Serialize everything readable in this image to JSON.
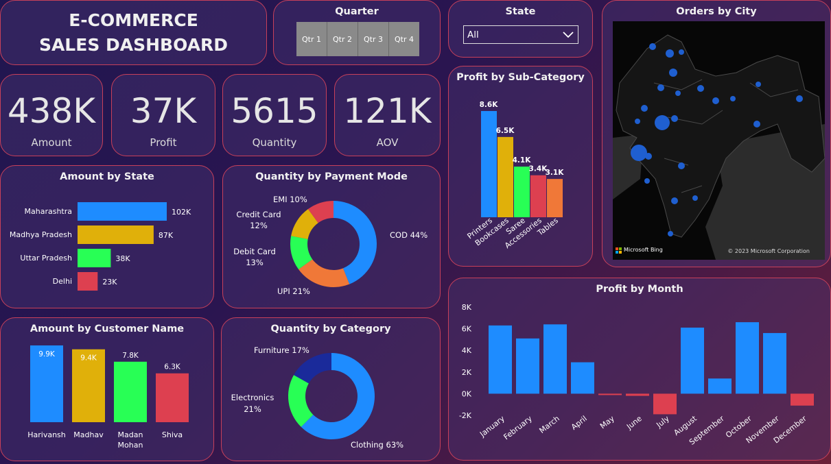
{
  "title": {
    "line1": "E-COMMERCE",
    "line2": "SALES DASHBOARD"
  },
  "quarter": {
    "title": "Quarter",
    "options": [
      "Qtr 1",
      "Qtr 2",
      "Qtr 3",
      "Qtr 4"
    ]
  },
  "state_filter": {
    "title": "State",
    "value": "All"
  },
  "kpis": [
    {
      "value": "438K",
      "label": "Amount"
    },
    {
      "value": "37K",
      "label": "Profit"
    },
    {
      "value": "5615",
      "label": "Quantity"
    },
    {
      "value": "121K",
      "label": "AOV"
    }
  ],
  "map": {
    "title": "Orders by City",
    "bing": "Microsoft Bing",
    "copyright": "© 2023 Microsoft Corporation"
  },
  "colors": {
    "blue": "#1e8cff",
    "gold": "#e0b00a",
    "green": "#28ff55",
    "red": "#dd4050",
    "orange": "#f07838",
    "navy": "#1a2a9a",
    "border": "#c8405a"
  },
  "chart_data": [
    {
      "id": "amount_by_state",
      "type": "bar",
      "orientation": "horizontal",
      "title": "Amount by State",
      "categories": [
        "Maharashtra",
        "Madhya Pradesh",
        "Uttar Pradesh",
        "Delhi"
      ],
      "values": [
        102,
        87,
        38,
        23
      ],
      "value_labels": [
        "102K",
        "87K",
        "38K",
        "23K"
      ],
      "colors": [
        "#1e8cff",
        "#e0b00a",
        "#28ff55",
        "#dd4050"
      ]
    },
    {
      "id": "quantity_by_payment_mode",
      "type": "pie",
      "donut": true,
      "title": "Quantity by Payment Mode",
      "slices": [
        {
          "label": "COD",
          "pct": "44%",
          "value": 44,
          "color": "#1e8cff"
        },
        {
          "label": "UPI",
          "pct": "21%",
          "value": 21,
          "color": "#f07838"
        },
        {
          "label": "Debit Card",
          "pct": "13%",
          "value": 13,
          "color": "#28ff55"
        },
        {
          "label": "Credit Card",
          "pct": "12%",
          "value": 12,
          "color": "#e0b00a"
        },
        {
          "label": "EMI",
          "pct": "10%",
          "value": 10,
          "color": "#dd4050"
        }
      ]
    },
    {
      "id": "profit_by_sub_category",
      "type": "bar",
      "title": "Profit by Sub-Category",
      "categories": [
        "Printers",
        "Bookcases",
        "Saree",
        "Accessories",
        "Tables"
      ],
      "values": [
        8.6,
        6.5,
        4.1,
        3.4,
        3.1
      ],
      "value_labels": [
        "8.6K",
        "6.5K",
        "4.1K",
        "3.4K",
        "3.1K"
      ],
      "colors": [
        "#1e8cff",
        "#e0b00a",
        "#28ff55",
        "#dd4050",
        "#f07838"
      ]
    },
    {
      "id": "amount_by_customer_name",
      "type": "bar",
      "title": "Amount by Customer Name",
      "categories": [
        "Harivansh",
        "Madhav",
        "Madan Mohan",
        "Shiva"
      ],
      "values": [
        9.9,
        9.4,
        7.8,
        6.3
      ],
      "value_labels": [
        "9.9K",
        "9.4K",
        "7.8K",
        "6.3K"
      ],
      "colors": [
        "#1e8cff",
        "#e0b00a",
        "#28ff55",
        "#dd4050"
      ]
    },
    {
      "id": "quantity_by_category",
      "type": "pie",
      "donut": true,
      "title": "Quantity by Category",
      "slices": [
        {
          "label": "Clothing",
          "pct": "63%",
          "value": 63,
          "color": "#1e8cff"
        },
        {
          "label": "Electronics",
          "pct": "21%",
          "value": 21,
          "color": "#28ff55"
        },
        {
          "label": "Furniture",
          "pct": "17%",
          "value": 17,
          "color": "#1a2a9a"
        }
      ]
    },
    {
      "id": "profit_by_month",
      "type": "bar",
      "title": "Profit by Month",
      "categories": [
        "January",
        "February",
        "March",
        "April",
        "May",
        "June",
        "July",
        "August",
        "September",
        "October",
        "November",
        "December"
      ],
      "values": [
        6300,
        5100,
        6400,
        2900,
        -100,
        -200,
        -1900,
        6100,
        1400,
        6600,
        5600,
        -1100
      ],
      "yticks": [
        "8K",
        "6K",
        "4K",
        "2K",
        "0K",
        "-2K"
      ],
      "ylim": [
        -2000,
        8000
      ]
    }
  ]
}
